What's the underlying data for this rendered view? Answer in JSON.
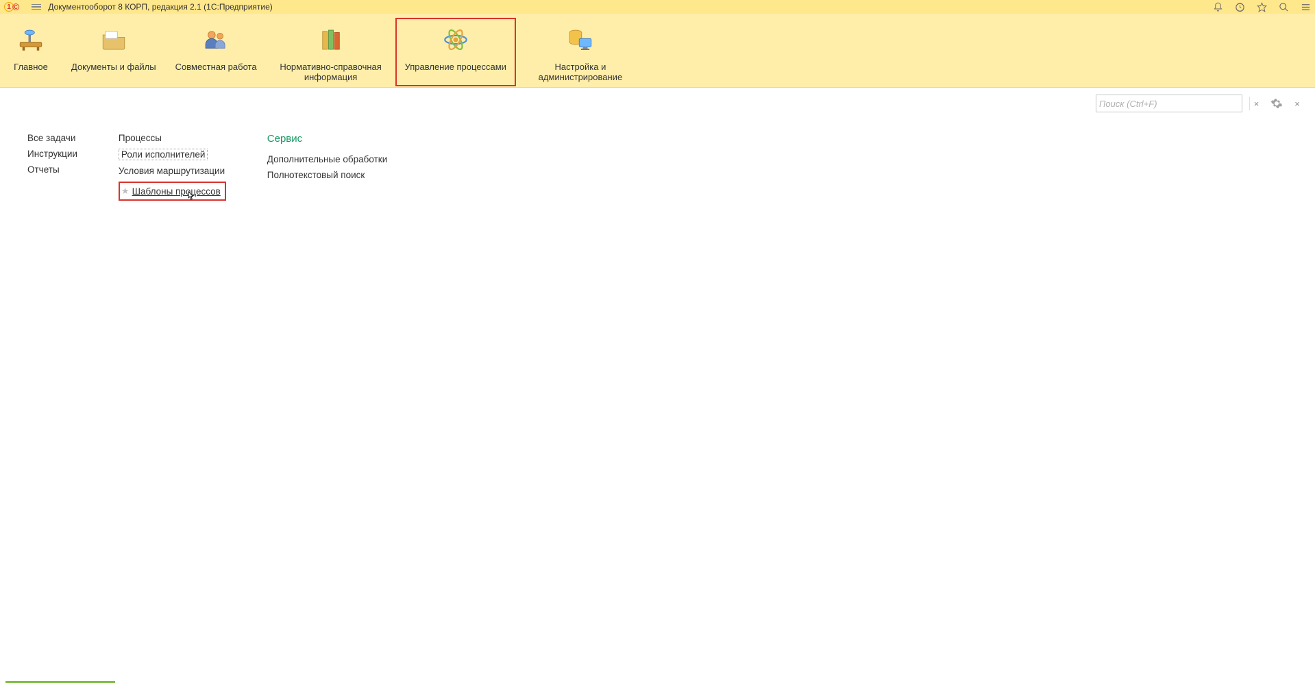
{
  "titlebar": {
    "title": "Документооборот 8 КОРП, редакция 2.1  (1С:Предприятие)"
  },
  "sections": [
    {
      "key": "home",
      "label": "Главное"
    },
    {
      "key": "docs",
      "label": "Документы и файлы"
    },
    {
      "key": "collab",
      "label": "Совместная работа"
    },
    {
      "key": "nsi",
      "label": "Нормативно-справочная информация"
    },
    {
      "key": "proc",
      "label": "Управление процессами",
      "active": true
    },
    {
      "key": "admin",
      "label": "Настройка и администрирование"
    }
  ],
  "search": {
    "placeholder": "Поиск (Ctrl+F)"
  },
  "nav": {
    "col1": [
      "Все задачи",
      "Инструкции",
      "Отчеты"
    ],
    "col2": {
      "items": [
        "Процессы",
        "Роли исполнителей",
        "Условия маршрутизации",
        "Шаблоны процессов"
      ]
    },
    "col3": {
      "heading": "Сервис",
      "items": [
        "Дополнительные обработки",
        "Полнотекстовый поиск"
      ]
    }
  }
}
